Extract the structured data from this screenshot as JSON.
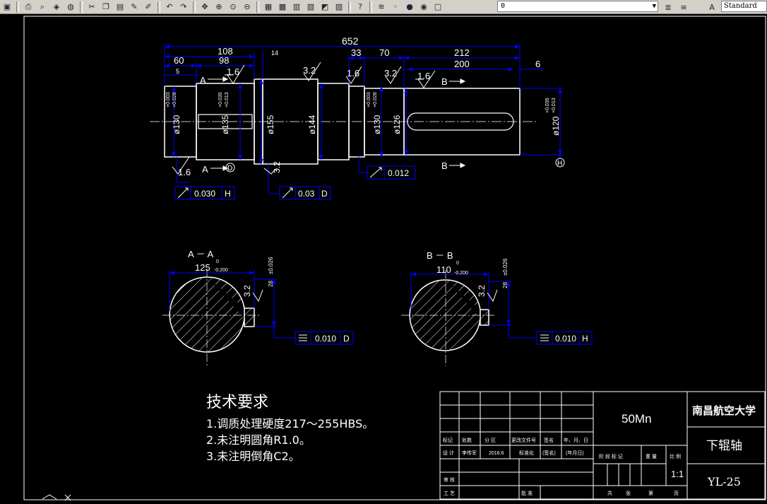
{
  "toolbar": {
    "layer_value": "0",
    "style_value": "Standard",
    "icons": [
      "save-icon",
      "print-icon",
      "preview-icon",
      "publish-icon",
      "plot-icon",
      "cut-icon",
      "copy-icon",
      "paste-icon",
      "matchprop-icon",
      "brush-icon",
      "undo-icon",
      "redo-icon",
      "pan-icon",
      "zoom-realtime-icon",
      "zoom-window-icon",
      "zoom-previous-icon",
      "properties-icon",
      "designcenter-icon",
      "toolpalette-icon",
      "sheetset-icon",
      "markup-icon",
      "calculator-icon",
      "help-icon",
      "layer-manager-icon",
      "bulb-icon",
      "sun-icon",
      "lock-icon",
      "color-icon",
      "layer-prev-icon",
      "layer-states-icon",
      "textstyle-icon"
    ]
  },
  "main_view": {
    "overall": "652",
    "d108": "108",
    "d98": "98",
    "d60": "60",
    "d5": "5",
    "d14": "14",
    "d33": "33",
    "d70": "70",
    "d212": "212",
    "d200": "200",
    "d6": "6",
    "r16a": "1.6",
    "r32a": "3.2",
    "r16b": "1.6",
    "r32b": "3.2",
    "r16c": "1.6",
    "r16d": "1.6",
    "r32c": "3.2",
    "dia130a": "ø130",
    "tol130a_up": "+0.003",
    "tol130a_lo": "+0.028",
    "dia135": "ø135",
    "tol135_up": "+0.035",
    "tol135_lo": "+0.013",
    "dia155": "ø155",
    "dia144": "ø144",
    "dia130b": "ø130",
    "tol130b_up": "+0.003",
    "tol130b_lo": "+0.028",
    "dia126": "ø126",
    "dia120": "ø120",
    "tol120_up": "+0.035",
    "tol120_lo": "+0.013",
    "sec_a": "A",
    "sec_a2": "A",
    "sec_b": "B",
    "sec_b2": "B",
    "datum_d": "D",
    "datum_h": "H",
    "fcf1_val": "0.030",
    "fcf1_ref": "H",
    "fcf2_val": "0.03",
    "fcf2_ref": "D",
    "fcf3_val": "0.012"
  },
  "section_a": {
    "title": "A － A",
    "width": "125",
    "tol_up": "0",
    "tol_lo": "-0.200",
    "depth": "28",
    "depth_tol": "±0.026",
    "rough": "3.2",
    "fcf_val": "0.010",
    "fcf_ref": "D"
  },
  "section_b": {
    "title": "B － B",
    "width": "110",
    "tol_up": "0",
    "tol_lo": "-0.200",
    "depth": "28",
    "depth_tol": "±0.026",
    "rough": "3.2",
    "fcf_val": "0.010",
    "fcf_ref": "H"
  },
  "notes": {
    "title": "技术要求",
    "lines": [
      "1.调质处理硬度217～255HBS。",
      "2.未注明圆角R1.0。",
      "3.未注明倒角C2。"
    ]
  },
  "title_block": {
    "material": "50Mn",
    "school": "南昌航空大学",
    "part_name": "下辊轴",
    "drawing_no": "YL-25",
    "scale": "1:1",
    "rev_headers": [
      "标记",
      "处数",
      "分 区",
      "更改文件号",
      "签名",
      "年、月、日"
    ],
    "design_row": [
      "设  计",
      "李传军",
      "2016.6",
      "标准化",
      "(签名)",
      "(年月日)"
    ],
    "stage_headers": [
      "阶 段 标 记",
      "重 量",
      "比 例"
    ],
    "audit": "审 核",
    "process": "工 艺",
    "approve": "批 准",
    "sheet_labels": [
      "共",
      "张",
      "第",
      "页"
    ]
  }
}
